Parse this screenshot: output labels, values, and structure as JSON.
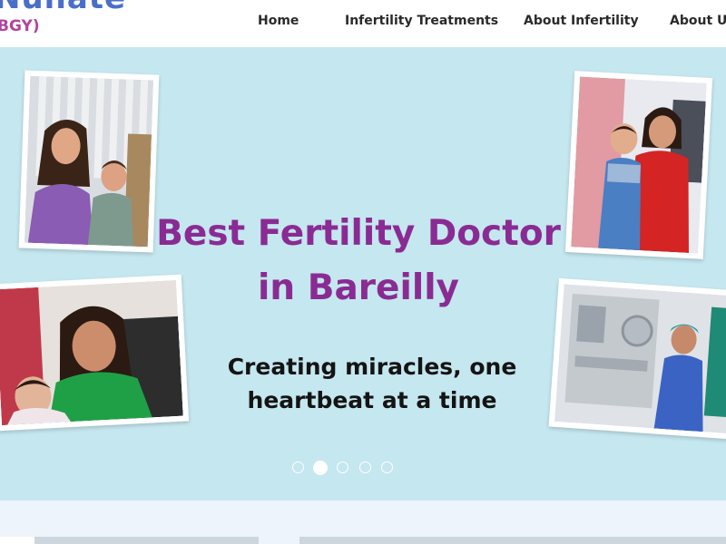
{
  "brand": {
    "name": "Nunate",
    "sub": "BGY)"
  },
  "nav": {
    "items": [
      {
        "label": "Home"
      },
      {
        "label": "Infertility Treatments"
      },
      {
        "label": "About Infertility"
      },
      {
        "label": "About Us"
      }
    ]
  },
  "hero": {
    "title_line1": "Best Fertility Doctor",
    "title_line2": "in Bareilly",
    "subtitle_line1": "Creating miracles, one",
    "subtitle_line2": "heartbeat at a time"
  },
  "carousel": {
    "slide_count": 5,
    "active_index": 1
  },
  "colors": {
    "hero_bg": "#c5e7ef",
    "title": "#8a2b93",
    "logo_blue": "#4a6fc8",
    "logo_pink": "#b0449e"
  }
}
